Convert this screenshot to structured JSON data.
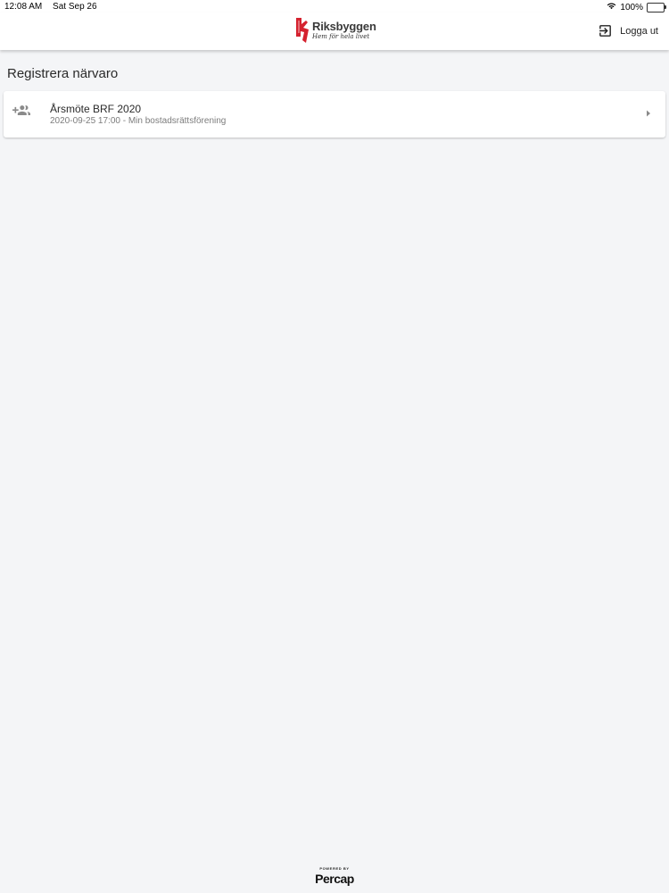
{
  "status_bar": {
    "time": "12:08 AM",
    "date": "Sat Sep 26",
    "battery": "100%"
  },
  "header": {
    "brand": "Riksbyggen",
    "tagline": "Hem för hela livet",
    "logout_label": "Logga ut"
  },
  "main": {
    "title": "Registrera närvaro",
    "items": [
      {
        "title": "Årsmöte BRF 2020",
        "subtitle": "2020-09-25 17:00 - Min bostadsrättsförening"
      }
    ]
  },
  "footer": {
    "powered_by": "POWERED BY",
    "vendor": "Percap"
  },
  "colors": {
    "brand_red": "#d5222f",
    "background": "#f4f5f7",
    "icon_gray": "#8a8a8a"
  },
  "icons": {
    "lead_item_icon": "group-add-icon",
    "logout_icon": "exit-icon",
    "item_chevron": "chevron-right-icon"
  }
}
